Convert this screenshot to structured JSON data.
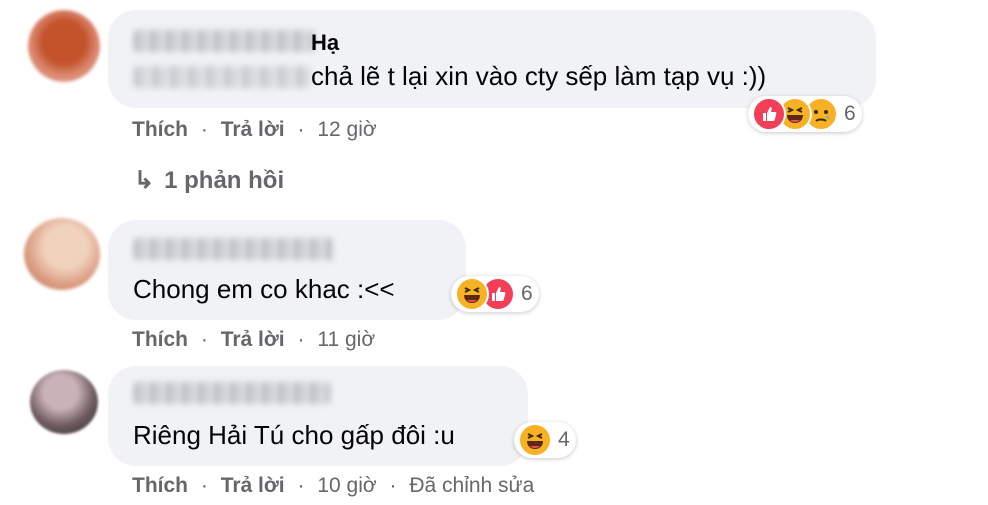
{
  "comments": [
    {
      "name_visible": "Hạ",
      "text": "chả lẽ t lại xin vào cty sếp làm tạp vụ :))",
      "actions": {
        "like": "Thích",
        "reply": "Trả lời",
        "time": "12 giờ"
      },
      "reaction_count": "6",
      "reactions": [
        "like-icon",
        "haha-icon",
        "sad-icon"
      ]
    },
    {
      "text": "Chong em co khac :<<",
      "actions": {
        "like": "Thích",
        "reply": "Trả lời",
        "time": "11 giờ"
      },
      "reaction_count": "6",
      "reactions": [
        "haha-icon",
        "like-icon"
      ]
    },
    {
      "text": "Riêng Hải Tú cho gấp đôi :u",
      "actions": {
        "like": "Thích",
        "reply": "Trả lời",
        "time": "10 giờ",
        "edited": "Đã chỉnh sửa"
      },
      "reaction_count": "4",
      "reactions": [
        "haha-icon"
      ]
    }
  ],
  "reply_link": {
    "arrow": "↳",
    "label": "1 phản hồi"
  },
  "separator": "·",
  "colors": {
    "bubble": "#f0f2f5",
    "meta": "#65676b",
    "like": "#f33e58",
    "haha": "#f7b125"
  }
}
